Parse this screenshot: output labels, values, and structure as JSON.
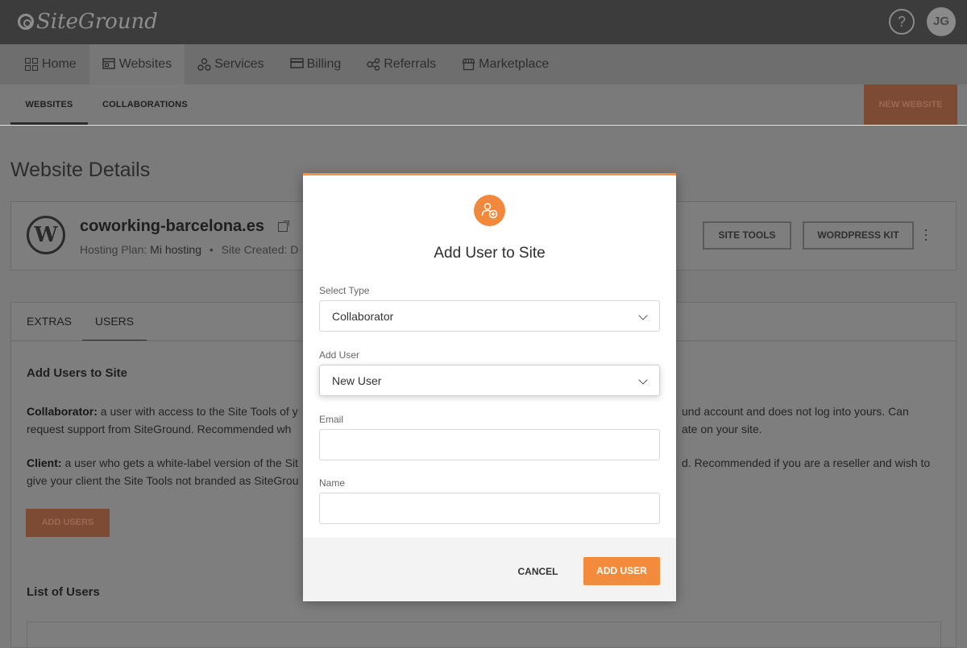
{
  "topbar": {
    "logo_text": "SiteGround",
    "help_symbol": "?",
    "avatar_initials": "JG"
  },
  "mainnav": {
    "items": [
      {
        "label": "Home",
        "icon": "grid-icon"
      },
      {
        "label": "Websites",
        "icon": "browser-window-icon"
      },
      {
        "label": "Services",
        "icon": "services-icon"
      },
      {
        "label": "Billing",
        "icon": "credit-card-icon"
      },
      {
        "label": "Referrals",
        "icon": "share-icon"
      },
      {
        "label": "Marketplace",
        "icon": "storefront-icon"
      }
    ],
    "active": "Websites"
  },
  "subnav": {
    "tabs": [
      {
        "label": "WEBSITES"
      },
      {
        "label": "COLLABORATIONS"
      }
    ],
    "new_website_label": "NEW WEBSITE"
  },
  "page": {
    "title": "Website Details",
    "site": {
      "name": "coworking-barcelona.es",
      "plan_label": "Hosting Plan:",
      "plan_value": "Mi hosting",
      "separator": "•",
      "created_label": "Site Created: D"
    },
    "site_tools_label": "SITE TOOLS",
    "wordpress_kit_label": "WORDPRESS KIT",
    "tabs": [
      {
        "label": "EXTRAS"
      },
      {
        "label": "USERS"
      }
    ],
    "add_users_heading": "Add Users to Site",
    "collaborator_term": "Collaborator:",
    "collaborator_text_left_1": "a user with access to the Site Tools of y",
    "collaborator_text_right_1": "und account and does not log into yours. Can",
    "collaborator_text_left_2": "request support from SiteGround. Recommended wh",
    "collaborator_text_right_2": "ate on your site.",
    "client_term": "Client:",
    "client_text_left_1": "a user who gets a white-label version of the Sit",
    "client_text_right_1": "d. Recommended if you are a reseller and wish to",
    "client_text_left_2": "give your client the Site Tools not branded as SiteGrou",
    "add_users_button": "ADD USERS",
    "list_heading": "List of Users"
  },
  "modal": {
    "icon": "add-user-icon",
    "title": "Add User to Site",
    "select_type_label": "Select Type",
    "select_type_value": "Collaborator",
    "add_user_label": "Add User",
    "add_user_value": "New User",
    "email_label": "Email",
    "email_value": "",
    "name_label": "Name",
    "name_value": "",
    "cancel_label": "CANCEL",
    "add_user_button": "ADD USER"
  },
  "colors": {
    "accent": "#f38b3c",
    "topbar": "#3c3c3c"
  }
}
